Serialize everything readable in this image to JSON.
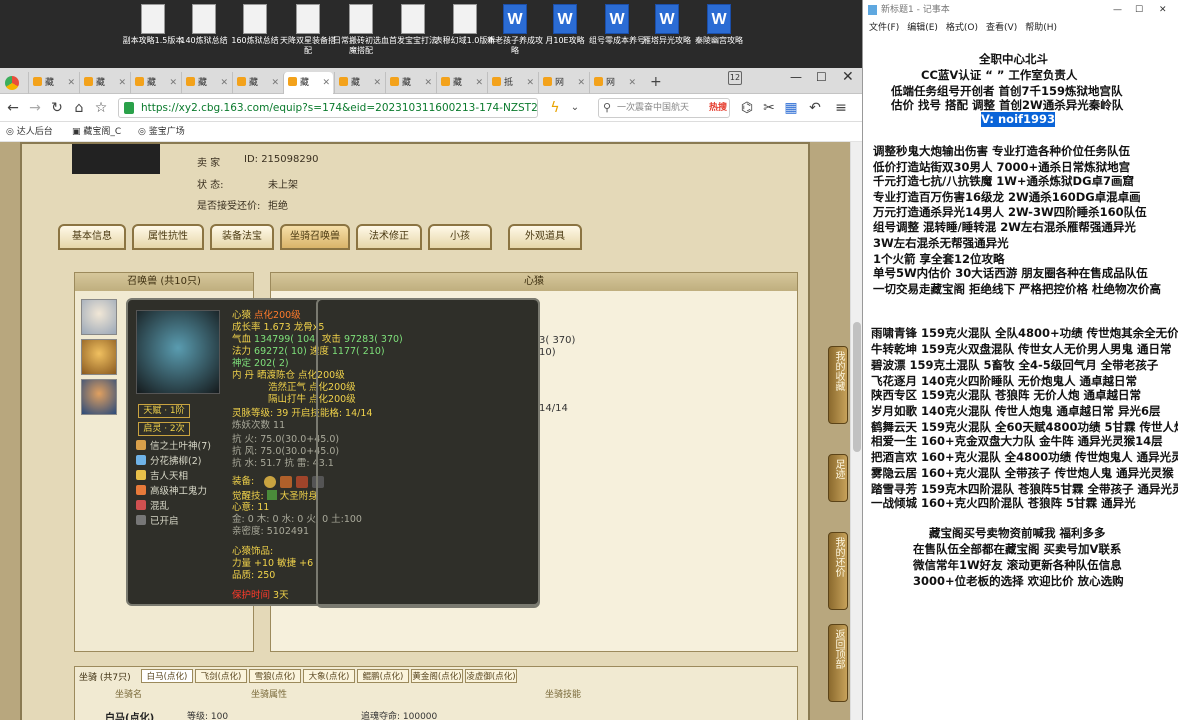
{
  "desktop": {
    "icons": [
      {
        "label": "副本攻略1.5版本",
        "type": "doc"
      },
      {
        "label": "140炼狱总结",
        "type": "doc"
      },
      {
        "label": "160炼狱总结",
        "type": "doc"
      },
      {
        "label": "天降双星装备搭配",
        "type": "doc"
      },
      {
        "label": "日常搬砖初选血魔搭配",
        "type": "doc"
      },
      {
        "label": "首发宝宝打法",
        "type": "doc"
      },
      {
        "label": "表穆幻域1.0版本",
        "type": "doc"
      },
      {
        "label": "新老孩子养成攻略",
        "type": "word"
      },
      {
        "label": "月10E攻略",
        "type": "word"
      },
      {
        "label": "组号零成本养号",
        "type": "word"
      },
      {
        "label": "雁塔异光攻略",
        "type": "word"
      },
      {
        "label": "秦陵幽宫攻略",
        "type": "word"
      }
    ]
  },
  "browser": {
    "tabs": [
      {
        "label": "藏"
      },
      {
        "label": "藏"
      },
      {
        "label": "藏"
      },
      {
        "label": "藏"
      },
      {
        "label": "藏"
      },
      {
        "label": "藏"
      },
      {
        "label": "藏"
      },
      {
        "label": "藏"
      },
      {
        "label": "藏"
      },
      {
        "label": "抵"
      },
      {
        "label": "网"
      },
      {
        "label": "网"
      }
    ],
    "tab_count": "12",
    "url": "https://xy2.cbg.163.com/equip?s=174&eid=202310311600213-174-NZST2UQEUPK9&v",
    "search_placeholder": "一次震奋中国航天",
    "search_badge": "热搜",
    "bookmarks": [
      "达人后台",
      "藏宝阁_C",
      "鉴宝广场"
    ]
  },
  "page": {
    "seller_label": "卖    家",
    "seller_id": "ID:  215098290",
    "status_label": "状        态:",
    "status_value": "未上架",
    "counter_label": "是否接受还价:",
    "counter_value": "拒绝",
    "tabs": [
      "基本信息",
      "属性抗性",
      "装备法宝",
      "坐骑召唤兽",
      "法术修正",
      "小孩",
      "外观道具"
    ],
    "selected_tab": "坐骑召唤兽",
    "summons_header": "召唤兽 (共10只)",
    "detail_header": "心猿",
    "bg_values": [
      "3( 370)",
      "10)",
      "14/14"
    ],
    "tooltip": {
      "name": "心猿",
      "name_suffix": "点化200级",
      "growth": "成长率 1.673  龙骨x5",
      "hp_label": "气血",
      "hp": "134799( 104)",
      "atk_label": "攻击",
      "atk": "97283( 370)",
      "mp_label": "法力",
      "mp": "69272( 10)",
      "spd_label": "速度",
      "spd": "1177( 210)",
      "char": "神定 202( 2)",
      "inner": "内    丹  晒渡陈仓 点化200级",
      "inner2": "浩然正气 点化200级",
      "inner3": "隔山打牛 点化200级",
      "spirit": "灵脉等级:  39  开启技能格: 14/14",
      "refine": "炼妖次数  11",
      "res1": "抗    火: 75.0(30.0+45.0)",
      "res2": "抗    风: 75.0(30.0+45.0)",
      "res3": "抗    水: 51.7 抗    雷: 43.1",
      "equip_label": "装备:",
      "awaken_label": "觉醒技:",
      "awaken_value": "大圣附身",
      "heart_label": "心意:  11",
      "elements": "金: 0 木: 0 水: 0 火: 0 土:100",
      "intimacy": "亲密度: 5102491",
      "deco_title": "心猿饰品:",
      "deco_stats": "力量 +10 敏捷 +6",
      "deco_quality": "品质: 250",
      "protect_label": "保护时间",
      "protect_value": "3天",
      "tianfu": "天赋 · 1阶",
      "qijue": "启灵 · 2次",
      "skills": [
        {
          "name": "信之土叶神(7)",
          "color": "#d9a04a"
        },
        {
          "name": "分花拂柳(2)",
          "color": "#6fb3e8"
        },
        {
          "name": "吉人天相",
          "color": "#e8c04a"
        },
        {
          "name": "高级神工鬼力",
          "color": "#e87a3a"
        },
        {
          "name": "混乱",
          "color": "#d05050"
        },
        {
          "name": "已开启",
          "color": "#777777"
        }
      ]
    },
    "mount_header": "坐骑 (共7只)",
    "mount_tabs": [
      "白马(点化)",
      "飞剑(点化)",
      "雪狼(点化)",
      "大象(点化)",
      "鲲鹏(点化)",
      "黄金阁(点化)",
      "凌虚御(点化)"
    ],
    "mount_cols": [
      "坐骑名",
      "坐骑属性",
      "坐骑技能"
    ],
    "mount_row": {
      "name": "白马(点化)",
      "level": "等级: 100",
      "life": "追魂夺命:  100000"
    },
    "side_buttons": [
      "我的收藏",
      "足迹",
      "我的还价",
      "返回顶部"
    ]
  },
  "notepad": {
    "title": "新标题1 - 记事本",
    "menu": [
      "文件(F)",
      "编辑(E)",
      "格式(O)",
      "查看(V)",
      "帮助(H)"
    ],
    "lines": [
      "全职中心北斗",
      "CC蓝V认证  “    ”  工作室负责人",
      "低端任务组号开创者            首创7千159炼狱地宫队",
      "估价 找号 搭配 调整           首创2W通杀异光秦岭队",
      "V: noif1993",
      "调整秒鬼大炮输出伤害          专业打造各种价位任务队伍",
      "低价打造站街双30男人          7000+通杀日常炼狱地宫",
      "千元打造七抗/八抗铁魔        1W+通杀炼狱DG卓7画窟",
      "专业打造百万伤害16级龙        2W通杀160DG卓混卓画",
      "万元打造通杀异光14男人        2W-3W四阶睡杀160队伍",
      "组号调整 混转睡/睡转混        2W左右混杀雁帮强通异光",
      "                               3W左右混杀无帮强通异光",
      "1个火箭 享全套12位攻略",
      "单号5W内估价 30大话西游        朋友圈各种在售成品队伍",
      "一切交易走藏宝阁 拒绝线下      严格把控价格 杜绝物次价高",
      "雨啸青锋 159克火混队 全队4800+功绩 传世炮其余全无价",
      "牛转乾坤 159克火双盘混队 传世女人无价男人男鬼 通日常",
      "碧波漂     159克土混队 5畜牧 全4-5级回气月 全带老孩子",
      "飞花逐月 140克火四阶睡队 无价炮鬼人 通卓越日常",
      "陕西专区 159克火混队 苍狼阵 无价人炮 通卓越日常",
      "岁月如歌 140克火混队 传世人炮鬼 通卓越日常 异光6层",
      "鹤舞云天 159克火混队 全60天赋4800功绩 5甘霖 传世人炮",
      "相爱一生 160+克金双盘大力队 金牛阵 通异光灵猴14层",
      "把酒言欢 160+克火混队 全4800功绩 传世炮鬼人 通异光灵猴",
      "雾隐云居 160+克火混队 全带孩子 传世炮人鬼 通异光灵猴",
      "踏雪寻芳 159克木四阶混队 苍狼阵5甘霖 全带孩子 通异光灵猴",
      "一战倾城 160+克火四阶混队 苍狼阵 5甘霖 通异光",
      "藏宝阁买号卖物资前喊我 福利多多",
      "在售队伍全部都在藏宝阁 买卖号加V联系",
      "微信常年1W好友 滚动更新各种队伍信息",
      "3000+位老板的选择 欢迎比价 放心选购"
    ]
  }
}
